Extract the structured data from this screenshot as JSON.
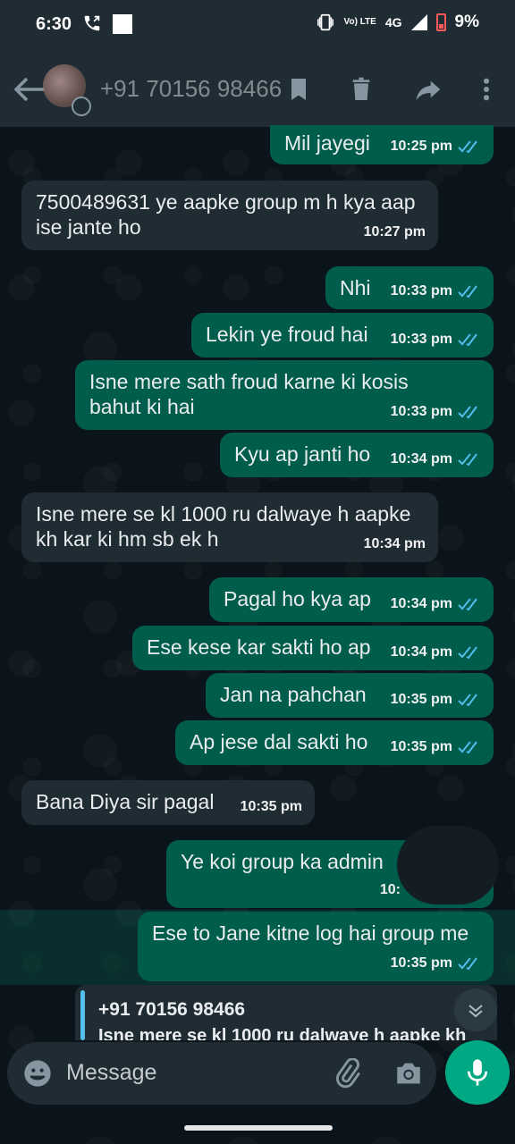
{
  "status": {
    "time": "6:30",
    "network": "4G",
    "volte": "Vo) LTE",
    "battery": "9%"
  },
  "header": {
    "title": "+91 70156 98466"
  },
  "colors": {
    "outgoing": "#005c4b",
    "incoming": "#202c33",
    "read_tick": "#53bdeb",
    "accent": "#00a884"
  },
  "messages": [
    {
      "text": "Mil jayegi",
      "time": "10:25 pm",
      "dir": "out"
    },
    {
      "text": "7500489631 ye aapke group m h kya aap\nise jante ho",
      "time": "10:27 pm",
      "dir": "in"
    },
    {
      "text": "Nhi",
      "time": "10:33 pm",
      "dir": "out"
    },
    {
      "text": "Lekin ye froud hai",
      "time": "10:33 pm",
      "dir": "out"
    },
    {
      "text": "Isne mere sath froud karne ki kosis\nbahut ki hai",
      "time": "10:33 pm",
      "dir": "out"
    },
    {
      "text": "Kyu ap janti ho",
      "time": "10:34 pm",
      "dir": "out"
    },
    {
      "text": "Isne mere se kl 1000 ru dalwaye h aapke\nkh kar ki hm sb ek h",
      "time": "10:34 pm",
      "dir": "in"
    },
    {
      "text": "Pagal ho kya ap",
      "time": "10:34 pm",
      "dir": "out"
    },
    {
      "text": "Ese kese kar sakti ho ap",
      "time": "10:34 pm",
      "dir": "out"
    },
    {
      "text": "Jan na pahchan",
      "time": "10:35 pm",
      "dir": "out"
    },
    {
      "text": "Ap jese dal sakti ho",
      "time": "10:35 pm",
      "dir": "out"
    },
    {
      "text": "Bana Diya sir pagal",
      "time": "10:35 pm",
      "dir": "in"
    },
    {
      "text": "Ye koi group ka admin",
      "time": "10:",
      "dir": "out"
    },
    {
      "text": "Ese to Jane kitne log hai group me",
      "time": "10:35 pm",
      "dir": "out"
    }
  ],
  "reply": {
    "name": "+91 70156 98466",
    "snippet": "Isne mere se kl 1000 ru dalwaye h aapke kh"
  },
  "composer": {
    "placeholder": "Message"
  }
}
